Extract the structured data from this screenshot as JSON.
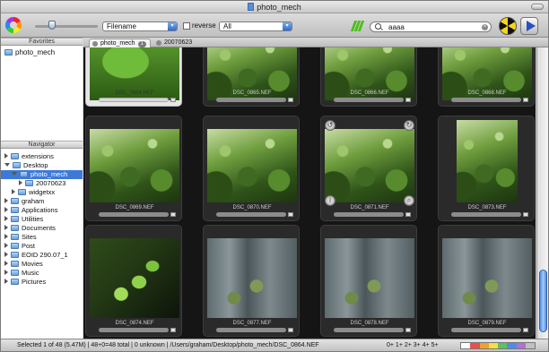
{
  "window": {
    "title": "photo_mech"
  },
  "toolbar": {
    "sort_value": "Filename",
    "reverse_label": "reverse",
    "filter_value": "All",
    "search_value": "aaaa"
  },
  "sidebar": {
    "favorites_header": "Favorites",
    "favorites": [
      {
        "label": "photo_mech"
      }
    ],
    "navigator_header": "Navigator",
    "nav_items": [
      {
        "label": "extensions",
        "depth": 0,
        "expanded": false,
        "selected": false
      },
      {
        "label": "Desktop",
        "depth": 0,
        "expanded": true,
        "selected": false
      },
      {
        "label": "photo_mech",
        "depth": 1,
        "expanded": true,
        "selected": true
      },
      {
        "label": "20070623",
        "depth": 2,
        "expanded": false,
        "selected": false
      },
      {
        "label": "widgetxx",
        "depth": 1,
        "expanded": false,
        "selected": false
      },
      {
        "label": "graham",
        "depth": 0,
        "expanded": false,
        "selected": false
      },
      {
        "label": "Applications",
        "depth": 0,
        "expanded": false,
        "selected": false
      },
      {
        "label": "Utilities",
        "depth": 0,
        "expanded": false,
        "selected": false
      },
      {
        "label": "Documents",
        "depth": 0,
        "expanded": false,
        "selected": false
      },
      {
        "label": "Sites",
        "depth": 0,
        "expanded": false,
        "selected": false
      },
      {
        "label": "Post",
        "depth": 0,
        "expanded": false,
        "selected": false
      },
      {
        "label": "EOID 290.07_1",
        "depth": 0,
        "expanded": false,
        "selected": false
      },
      {
        "label": "Movies",
        "depth": 0,
        "expanded": false,
        "selected": false
      },
      {
        "label": "Music",
        "depth": 0,
        "expanded": false,
        "selected": false
      },
      {
        "label": "Pictures",
        "depth": 0,
        "expanded": false,
        "selected": false
      }
    ]
  },
  "tabs": [
    {
      "label": "photo_mech",
      "badge": "1",
      "active": true
    },
    {
      "label": "20070623",
      "badge": "",
      "active": false
    }
  ],
  "thumbnails": [
    {
      "filename": "DSC_0864.NEF",
      "photo": "leaf-top",
      "selected": true
    },
    {
      "filename": "DSC_0865.NEF",
      "photo": "tree",
      "selected": false
    },
    {
      "filename": "DSC_0866.NEF",
      "photo": "tree",
      "selected": false
    },
    {
      "filename": "DSC_0868.NEF",
      "photo": "tree",
      "selected": false
    },
    {
      "filename": "DSC_0869.NEF",
      "photo": "tree",
      "selected": false
    },
    {
      "filename": "DSC_0870.NEF",
      "photo": "tree",
      "selected": false
    },
    {
      "filename": "DSC_0871.NEF",
      "photo": "tree",
      "selected": false
    },
    {
      "filename": "DSC_0873.NEF",
      "photo": "tree-portrait",
      "selected": false
    },
    {
      "filename": "DSC_0874.NEF",
      "photo": "leaf",
      "selected": false
    },
    {
      "filename": "DSC_0877.NEF",
      "photo": "grey",
      "selected": false
    },
    {
      "filename": "DSC_0878.NEF",
      "photo": "grey",
      "selected": false
    },
    {
      "filename": "DSC_0879.NEF",
      "photo": "grey",
      "selected": false
    }
  ],
  "status": {
    "text": "Selected 1 of 48 (5.47M) | 48+0=48 total | 0 unknown | /Users/graham/Desktop/photo_mech/DSC_0864.NEF",
    "ratings": "0+ 1+ 2+ 3+ 4+ 5+"
  },
  "colors": {
    "selection_blue": "#3d7ad8",
    "grid_background": "#151515",
    "label_colors": [
      "#ffffff",
      "#e85050",
      "#f0a030",
      "#f5e040",
      "#60c060",
      "#4f8ee6",
      "#b070d8",
      "#c0c0c0"
    ]
  },
  "icons": [
    "app-logo-icon",
    "search-icon",
    "clear-search-icon",
    "radiation-icon",
    "slideshow-play-icon",
    "folder-icon",
    "rotate-left-icon",
    "rotate-right-icon",
    "info-icon",
    "zoom-icon"
  ]
}
